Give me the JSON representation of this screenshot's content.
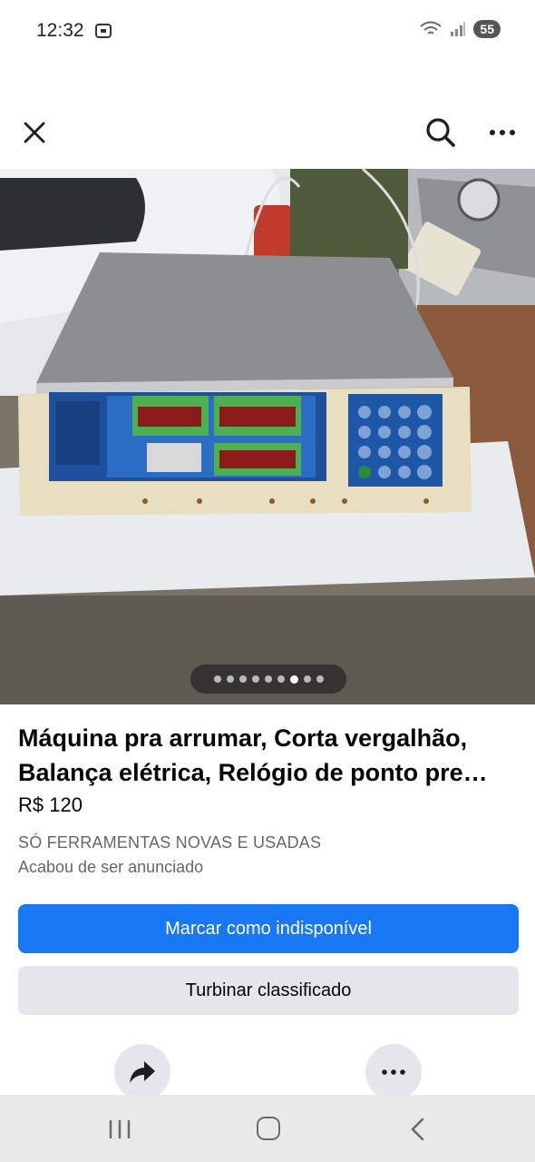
{
  "status_bar": {
    "time": "12:32",
    "battery": "55"
  },
  "top_bar": {
    "icons": [
      "close-icon",
      "search-icon",
      "more-icon"
    ]
  },
  "photo": {
    "icon": "product-photo",
    "page_count": 9,
    "active_index": 6
  },
  "listing": {
    "title_line1": "Máquina pra arrumar, Corta vergalhão,",
    "title_line2": "Balança elétrica, Relógio de ponto pre…",
    "price": "R$ 120",
    "seller": "SÓ FERRAMENTAS NOVAS E USADAS",
    "posted": "Acabou de ser anunciado"
  },
  "actions": {
    "mark_unavailable": "Marcar como indisponível",
    "boost": "Turbinar classificado"
  },
  "colors": {
    "primary": "#1877f2",
    "secondary_bg": "#e4e6eb"
  }
}
